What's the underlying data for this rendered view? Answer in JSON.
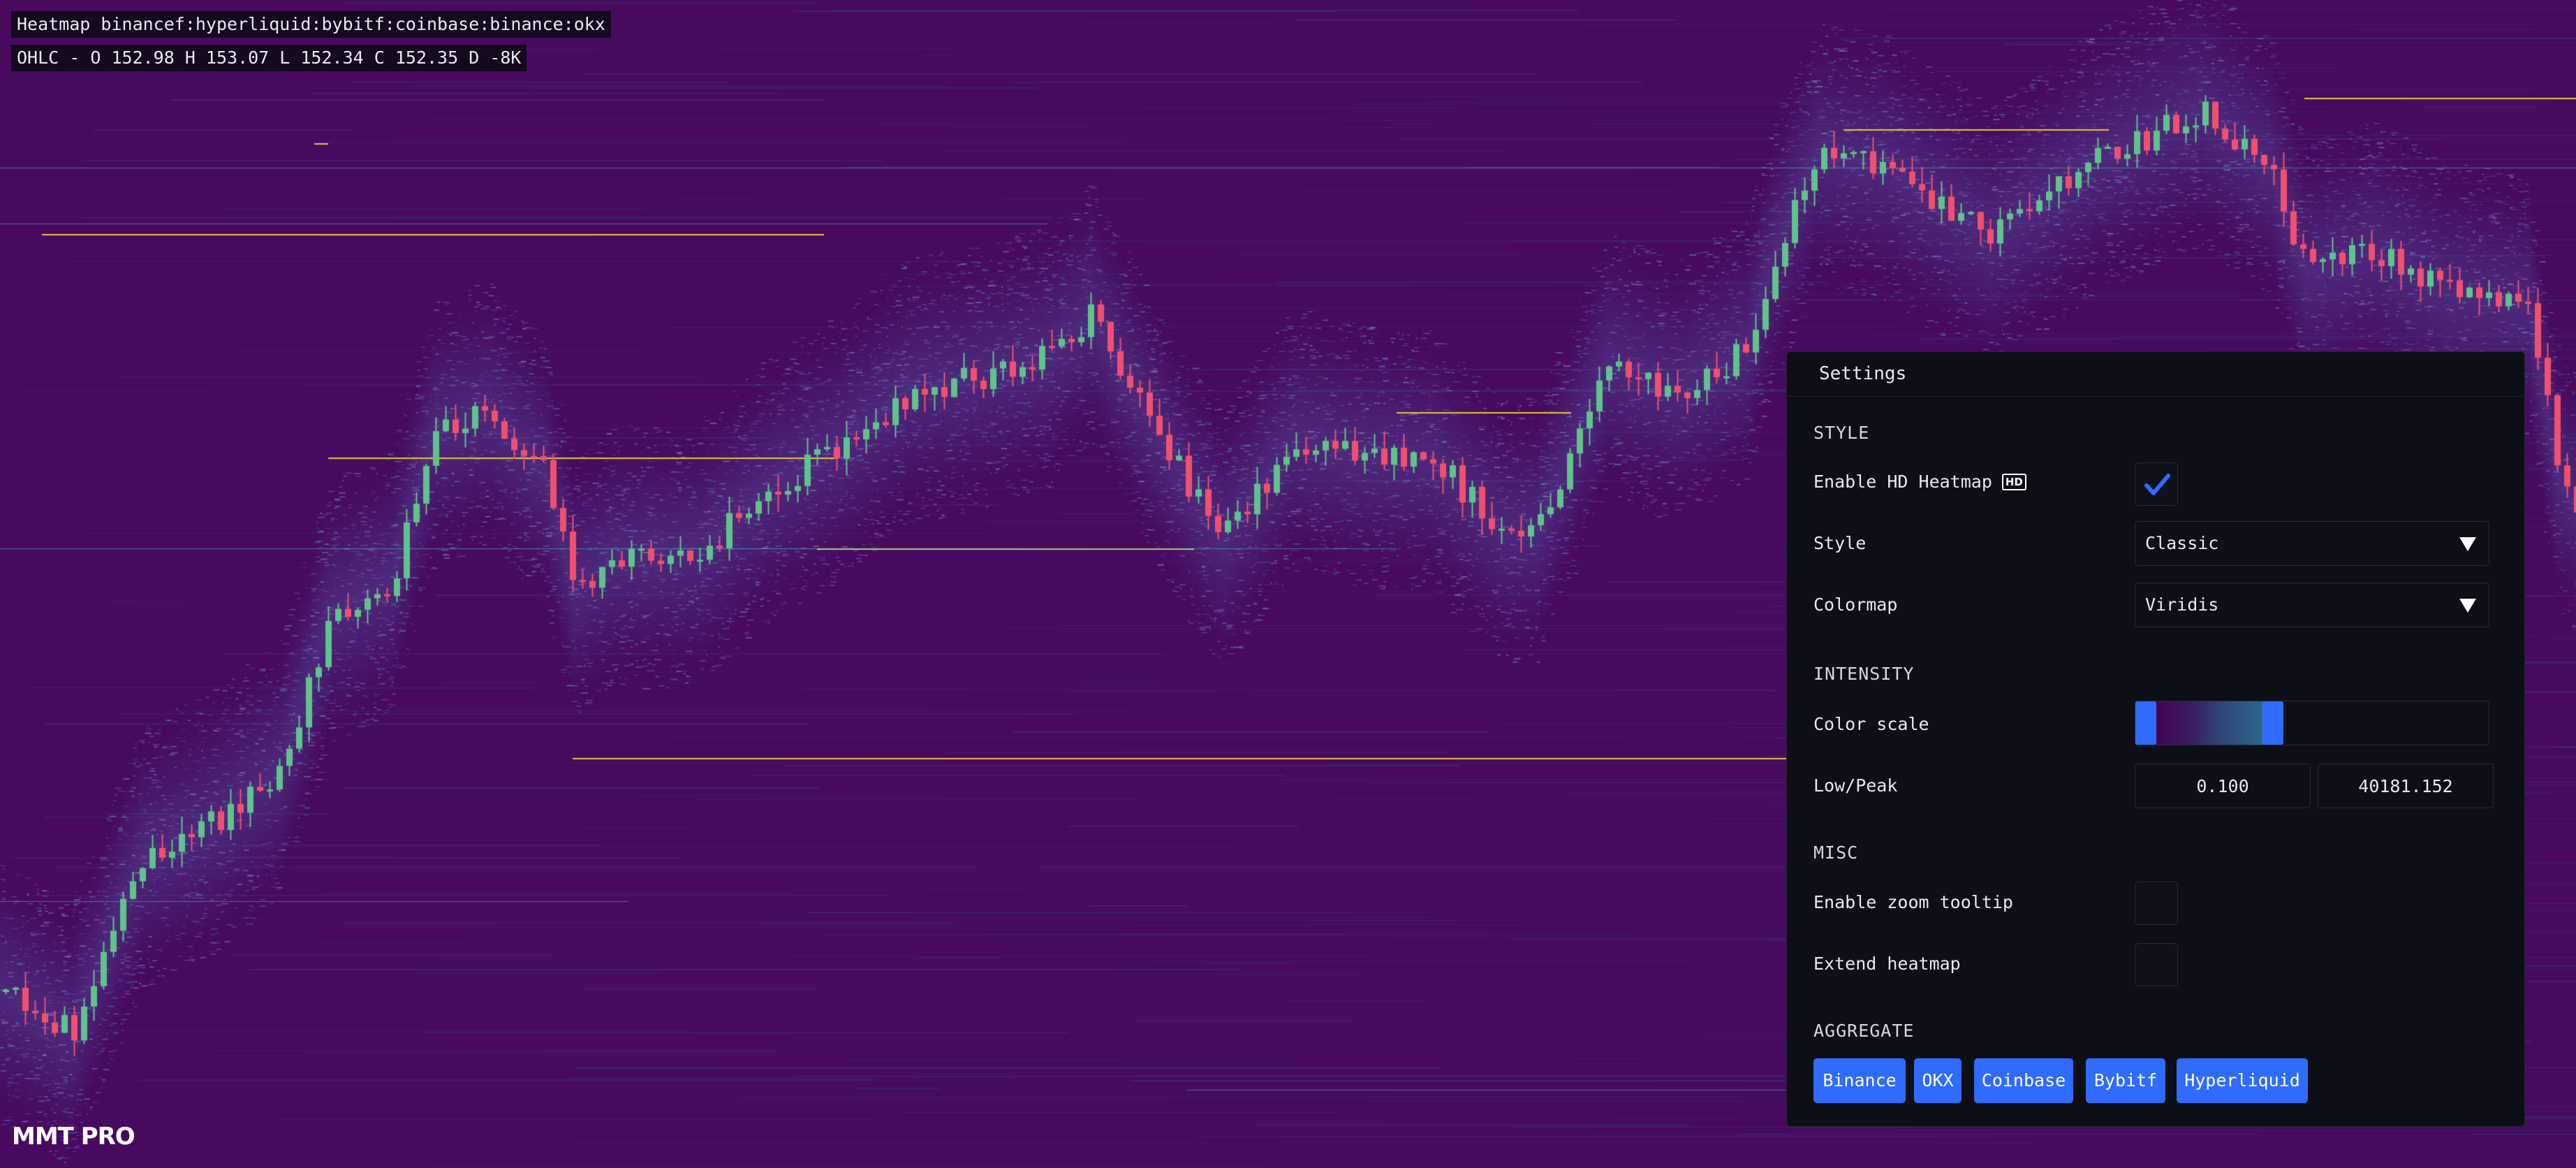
{
  "header": {
    "title": "Heatmap binancef:hyperliquid:bybitf:coinbase:binance:okx",
    "ohlc": "OHLC - O 152.98 H 153.07 L 152.34 C 152.35 D -8K"
  },
  "logo": {
    "text": "MMT PRO"
  },
  "colors": {
    "background": "#470a5e",
    "candle_up": "#5fc38a",
    "candle_down": "#f0506e",
    "accent": "#2f6bff",
    "panel": "#0c0f15",
    "level_line": "#e6c53a"
  },
  "settings": {
    "title": "Settings",
    "style_section": "STYLE",
    "enable_hd_label": "Enable HD Heatmap",
    "hd_badge": "HD",
    "enable_hd_checked": true,
    "style_label": "Style",
    "style_value": "Classic",
    "colormap_label": "Colormap",
    "colormap_value": "Viridis",
    "intensity_section": "INTENSITY",
    "color_scale_label": "Color scale",
    "low_peak_label": "Low/Peak",
    "low_value": "0.100",
    "peak_value": "40181.152",
    "misc_section": "MISC",
    "zoom_tooltip_label": "Enable zoom tooltip",
    "zoom_tooltip_checked": false,
    "extend_heatmap_label": "Extend heatmap",
    "extend_heatmap_checked": false,
    "aggregate_section": "AGGREGATE",
    "exchanges": [
      "Binance",
      "OKX",
      "Coinbase",
      "Bybitf",
      "Hyperliquid"
    ]
  }
}
